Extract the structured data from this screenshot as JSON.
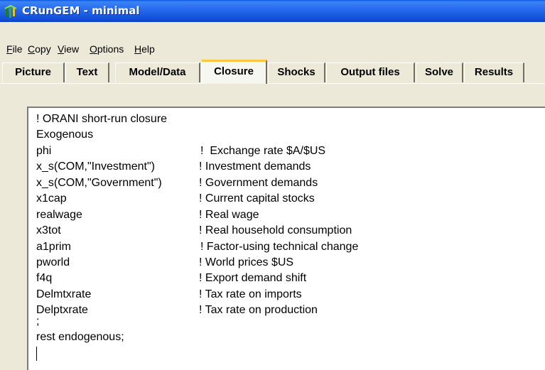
{
  "window": {
    "title": "CRunGEM - minimal",
    "icon": "tree-icon"
  },
  "menu": [
    {
      "label": "File",
      "key": "F",
      "rest": "ile"
    },
    {
      "label": "Copy",
      "key": "C",
      "rest": "opy"
    },
    {
      "label": "View",
      "key": "V",
      "rest": "iew"
    },
    {
      "label": "Options",
      "key": "O",
      "rest": "ptions"
    },
    {
      "label": "Help",
      "key": "H",
      "rest": "elp"
    }
  ],
  "tabs": [
    {
      "label": "Picture",
      "active": false
    },
    {
      "label": "Text",
      "active": false
    },
    {
      "label": "Model/Data",
      "active": false
    },
    {
      "label": "Closure",
      "active": true
    },
    {
      "label": "Shocks",
      "active": false
    },
    {
      "label": "Output files",
      "active": false
    },
    {
      "label": "Solve",
      "active": false
    },
    {
      "label": "Results",
      "active": false
    }
  ],
  "editor": {
    "header": "! ORANI short-run closure",
    "section": "Exogenous",
    "rows": [
      {
        "var": "phi",
        "comment": "!  Exchange rate $A/$US"
      },
      {
        "var": "x_s(COM,\"Investment\")",
        "comment": "! Investment demands"
      },
      {
        "var": "x_s(COM,\"Government\")",
        "comment": "! Government demands"
      },
      {
        "var": "x1cap",
        "comment": "! Current capital stocks"
      },
      {
        "var": "realwage",
        "comment": "! Real wage"
      },
      {
        "var": "x3tot",
        "comment": "! Real household consumption"
      },
      {
        "var": "a1prim",
        "comment": "! Factor-using technical change"
      },
      {
        "var": "pworld",
        "comment": "! World prices $US"
      },
      {
        "var": "f4q",
        "comment": "! Export demand shift"
      },
      {
        "var": "Delmtxrate",
        "comment": "! Tax rate on imports"
      },
      {
        "var": "Delptxrate",
        "comment": "! Tax rate on production"
      }
    ],
    "separator": ";",
    "footer": "rest endogenous;"
  },
  "colors": {
    "titlebar": "#2a6cf0",
    "active_tab_accent": "#ffc83c",
    "chrome": "#ece9d8"
  }
}
